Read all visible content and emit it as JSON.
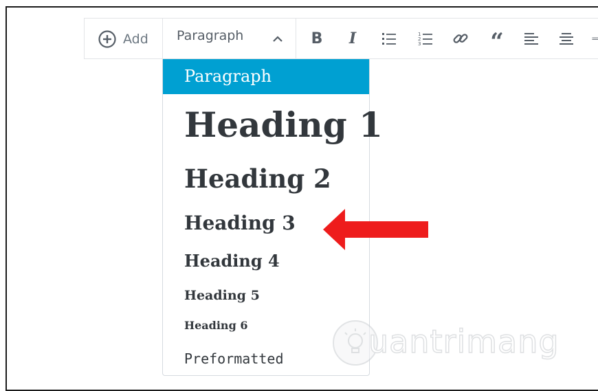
{
  "toolbar": {
    "add_label": "Add",
    "block_type": "Paragraph",
    "icons": [
      "plus-circle-icon",
      "chevron-up-icon",
      "bold-icon",
      "italic-icon",
      "bullet-list-icon",
      "numbered-list-icon",
      "link-icon",
      "quote-icon",
      "align-left-icon",
      "align-center-icon"
    ],
    "bold_glyph": "B",
    "italic_glyph": "I",
    "quote_glyph": "“"
  },
  "dropdown": {
    "items": [
      {
        "label": "Paragraph",
        "selected": true
      },
      {
        "label": "Heading 1"
      },
      {
        "label": "Heading 2"
      },
      {
        "label": "Heading 3"
      },
      {
        "label": "Heading 4"
      },
      {
        "label": "Heading 5"
      },
      {
        "label": "Heading 6"
      },
      {
        "label": "Preformatted"
      }
    ]
  },
  "annotation": {
    "arrow_color": "#ee1c1c"
  },
  "watermark": {
    "text": "uantrimang"
  },
  "colors": {
    "accent": "#00a0d2",
    "text": "#32373c",
    "icon": "#555d66"
  }
}
